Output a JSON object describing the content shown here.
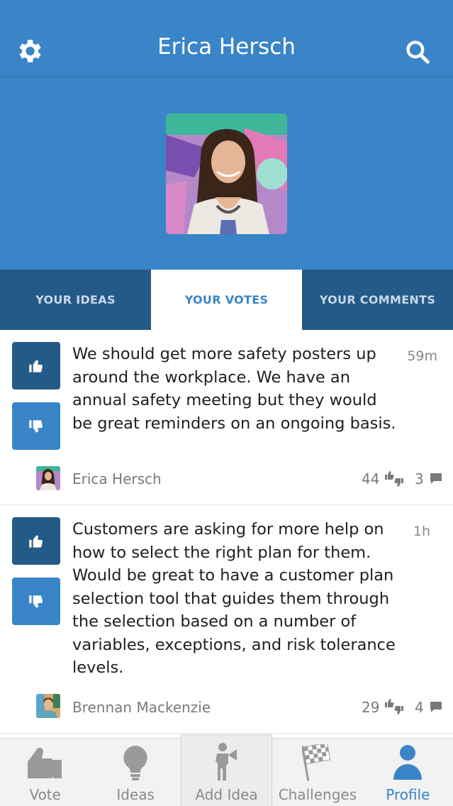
{
  "header": {
    "title": "Erica Hersch",
    "settings_icon": "gear-icon",
    "search_icon": "search-icon",
    "background_color": "#3a85c7"
  },
  "tabs": [
    {
      "label": "YOUR IDEAS",
      "active": false
    },
    {
      "label": "YOUR VOTES",
      "active": true
    },
    {
      "label": "YOUR COMMENTS",
      "active": false
    }
  ],
  "ideas": [
    {
      "text": "We should get more safety posters up around the workplace. We have an annual safety meeting but they would be great reminders on an ongoing basis.",
      "time": "59m",
      "author": "Erica Hersch",
      "votes": "44",
      "comments": "3"
    },
    {
      "text": "Customers are asking for more help on how to select the right plan for them. Would be great to have a customer plan selection tool that guides them through the selection based on a number of variables, exceptions, and risk tolerance levels.",
      "time": "1h",
      "author": "Brennan Mackenzie",
      "votes": "29",
      "comments": "4"
    }
  ],
  "nav": [
    {
      "label": "Vote",
      "icon": "thumbs-up-icon",
      "active": false
    },
    {
      "label": "Ideas",
      "icon": "lightbulb-icon",
      "active": false
    },
    {
      "label": "Add Idea",
      "icon": "megaphone-person-icon",
      "active": false
    },
    {
      "label": "Challenges",
      "icon": "checkered-flag-icon",
      "active": false
    },
    {
      "label": "Profile",
      "icon": "person-icon",
      "active": true
    }
  ],
  "colors": {
    "primary": "#3a85c7",
    "dark": "#245a87",
    "active_nav": "#3a85c7"
  }
}
